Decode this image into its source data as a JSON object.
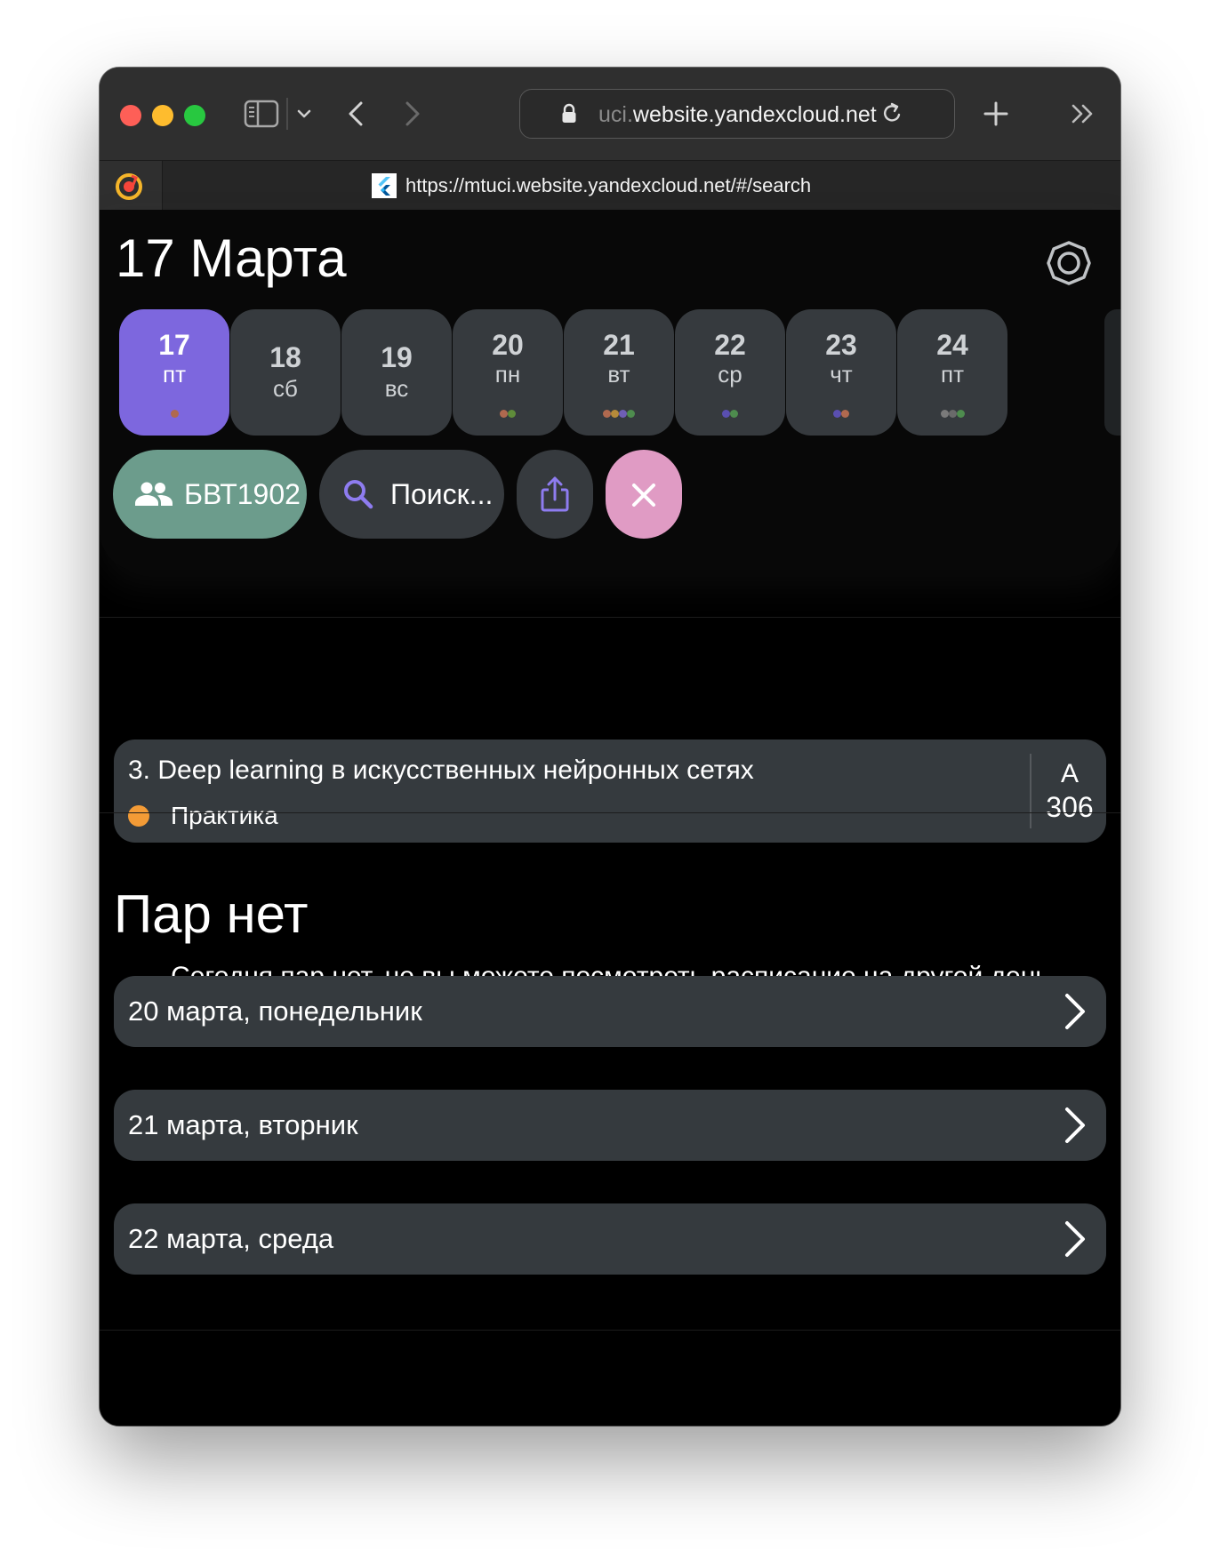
{
  "browser": {
    "url_faint": "uci.",
    "url_main": "website.yandexcloud.net",
    "tab_title": "https://mtuci.website.yandexcloud.net/#/search"
  },
  "colors": {
    "accent": "#7d67de",
    "group_chip": "#6c9c8c",
    "close_chip": "#e09bc4",
    "card": "#353a3e",
    "practice": "#f39b36"
  },
  "header": {
    "date_title": "17 Марта"
  },
  "days": [
    {
      "num": "17",
      "weekday": "пт",
      "active": true,
      "dots": [
        "#b0694f"
      ]
    },
    {
      "num": "18",
      "weekday": "сб",
      "active": false,
      "dots": []
    },
    {
      "num": "19",
      "weekday": "вс",
      "active": false,
      "dots": []
    },
    {
      "num": "20",
      "weekday": "пн",
      "active": false,
      "dots": [
        "#b0694f",
        "#5f8c3a"
      ]
    },
    {
      "num": "21",
      "weekday": "вт",
      "active": false,
      "dots": [
        "#b0694f",
        "#b58a3a",
        "#6f5fb5",
        "#4e8c4e"
      ]
    },
    {
      "num": "22",
      "weekday": "ср",
      "active": false,
      "dots": [
        "#5a4fb0",
        "#4e8c4e"
      ]
    },
    {
      "num": "23",
      "weekday": "чт",
      "active": false,
      "dots": [
        "#5a4fb0",
        "#b0694f"
      ]
    },
    {
      "num": "24",
      "weekday": "пт",
      "active": false,
      "dots": [
        "#7a7a7a",
        "#6a6a6a",
        "#4e8c4e"
      ]
    }
  ],
  "actions": {
    "group_label": "БВТ1902",
    "search_label": "Поиск..."
  },
  "lesson": {
    "title": "3. Deep learning в искусственных нейронных сетях",
    "type": "Практика",
    "room_building": "А",
    "room_number": "306"
  },
  "empty": {
    "title": "Пар нет",
    "description": "Сегодня пар нет, но вы можете посмотреть расписание на другой день"
  },
  "other_days": [
    {
      "label": "20 марта, понедельник"
    },
    {
      "label": "21 марта, вторник"
    },
    {
      "label": "22 марта, среда"
    }
  ]
}
